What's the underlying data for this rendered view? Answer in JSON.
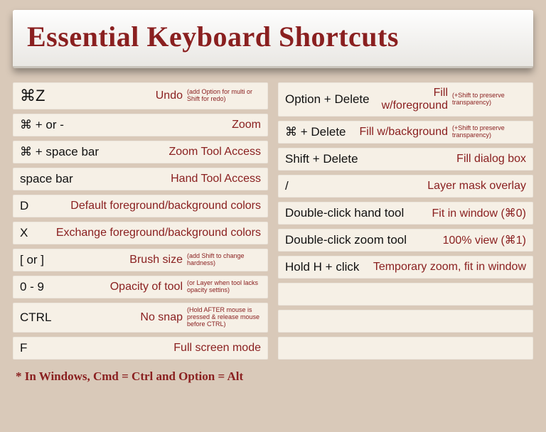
{
  "title": "Essential Keyboard Shortcuts",
  "footnote": "* In Windows, Cmd = Ctrl and Option = Alt",
  "left": [
    {
      "keys": "⌘Z",
      "action": "Undo",
      "note": "(add Option for multi or Shift for redo)",
      "big": true
    },
    {
      "keys": "⌘ + or -",
      "action": "Zoom"
    },
    {
      "keys": "⌘ + space bar",
      "action": "Zoom Tool Access"
    },
    {
      "keys": "space bar",
      "action": "Hand Tool Access"
    },
    {
      "keys": "D",
      "action": "Default foreground/background colors"
    },
    {
      "keys": "X",
      "action": "Exchange foreground/background colors"
    },
    {
      "keys": "[ or ]",
      "action": "Brush size",
      "note": "(add Shift to change hardness)"
    },
    {
      "keys": "0 - 9",
      "action": "Opacity of tool",
      "note": "(or Layer when tool lacks opacity settins)"
    },
    {
      "keys": "CTRL",
      "action": "No snap",
      "note": "(Hold AFTER mouse is pressed & release mouse before CTRL)"
    },
    {
      "keys": "F",
      "action": "Full screen mode"
    }
  ],
  "right": [
    {
      "keys": "Option + Delete",
      "action": "Fill w/foreground",
      "note": "(+Shift to preserve transparency)"
    },
    {
      "keys": "⌘ + Delete",
      "action": "Fill w/background",
      "note": "(+Shift to preserve transparency)"
    },
    {
      "keys": "Shift + Delete",
      "action": "Fill dialog box"
    },
    {
      "keys": "/",
      "action": "Layer mask overlay"
    },
    {
      "keys": "Double-click hand tool",
      "action": "Fit in window (⌘0)"
    },
    {
      "keys": "Double-click zoom tool",
      "action": "100% view (⌘1)"
    },
    {
      "keys": "Hold H + click",
      "action": "Temporary zoom, fit in window"
    },
    {
      "empty": true
    },
    {
      "empty": true
    },
    {
      "empty": true
    }
  ]
}
